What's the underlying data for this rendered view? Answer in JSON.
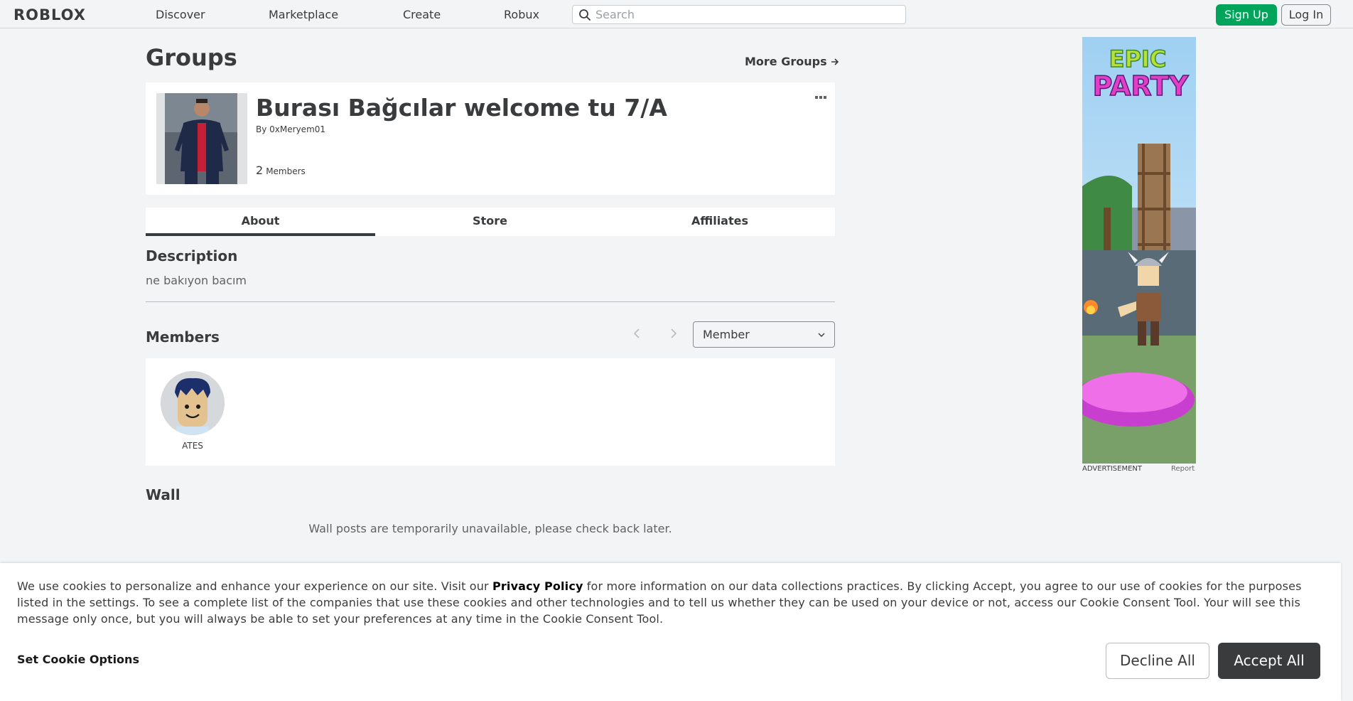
{
  "nav": {
    "logo": "ROBLOX",
    "links": [
      "Discover",
      "Marketplace",
      "Create",
      "Robux"
    ],
    "search_placeholder": "Search",
    "signup": "Sign Up",
    "login": "Log In"
  },
  "page": {
    "title": "Groups",
    "more_groups": "More Groups"
  },
  "group": {
    "name": "Burası Bağcılar welcome tu 7/A",
    "owner_prefix": "By",
    "owner": "0xMeryem01",
    "member_count": "2",
    "member_label": "Members"
  },
  "tabs": [
    "About",
    "Store",
    "Affiliates"
  ],
  "description": {
    "title": "Description",
    "text": "ne bakıyon bacım"
  },
  "members": {
    "title": "Members",
    "role_selected": "Member",
    "list": [
      {
        "name": "ATES"
      }
    ]
  },
  "wall": {
    "title": "Wall",
    "message": "Wall posts are temporarily unavailable, please check back later."
  },
  "ad": {
    "heading_line1": "EPIC",
    "heading_line2": "PARTY",
    "label": "ADVERTISEMENT",
    "report": "Report"
  },
  "cookie": {
    "text_before": "We use cookies to personalize and enhance your experience on our site. Visit our ",
    "policy_link": "Privacy Policy",
    "text_after": " for more information on our data collections practices. By clicking Accept, you agree to our use of cookies for the purposes listed in the settings. To see a complete list of the companies that use these cookies and other technologies and to tell us whether they can be used on your device or not, access our Cookie Consent Tool. Your will see this message only once, but you will always be able to set your preferences at any time in the Cookie Consent Tool.",
    "options": "Set Cookie Options",
    "decline": "Decline All",
    "accept": "Accept All"
  },
  "colors": {
    "page_bg": "#f2f4f5",
    "signup_green": "#00a55b",
    "dark": "#393b3d",
    "ad_pink": "#e23fc7"
  }
}
